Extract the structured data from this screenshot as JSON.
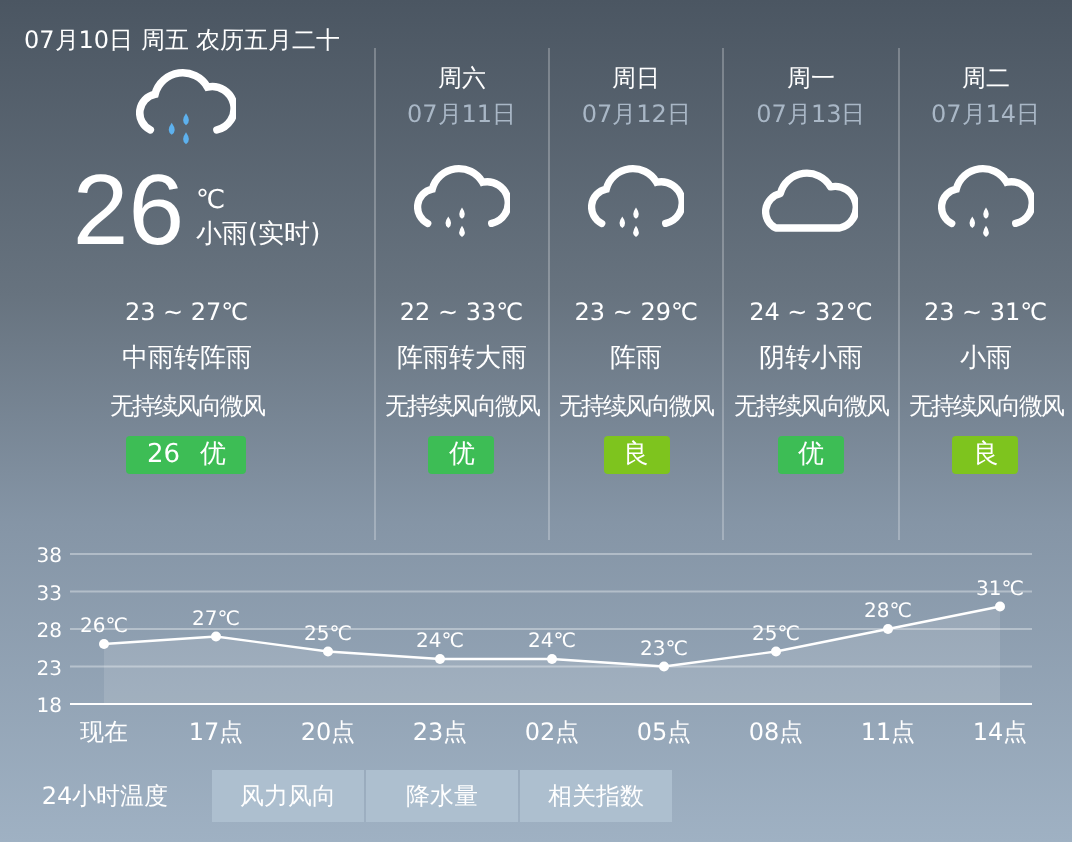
{
  "header": {
    "date_line": "07月10日 周五 农历五月二十"
  },
  "today": {
    "kind": "rain",
    "temperature": "26",
    "unit": "℃",
    "condition": "小雨(实时)",
    "range": "23 ~ 27℃",
    "forecast": "中雨转阵雨",
    "wind": "无持续风向微风",
    "aqi": {
      "label": "26 优",
      "color": "#3dbd55"
    }
  },
  "days": [
    {
      "weekday": "周六",
      "date": "07月11日",
      "kind": "rain",
      "range": "22 ~ 33℃",
      "forecast": "阵雨转大雨",
      "wind": "无持续风向微风",
      "aqi": {
        "label": "优",
        "color": "#3dbd55"
      }
    },
    {
      "weekday": "周日",
      "date": "07月12日",
      "kind": "rain",
      "range": "23 ~ 29℃",
      "forecast": "阵雨",
      "wind": "无持续风向微风",
      "aqi": {
        "label": "良",
        "color": "#7ec41e"
      }
    },
    {
      "weekday": "周一",
      "date": "07月13日",
      "kind": "cloud",
      "range": "24 ~ 32℃",
      "forecast": "阴转小雨",
      "wind": "无持续风向微风",
      "aqi": {
        "label": "优",
        "color": "#3dbd55"
      }
    },
    {
      "weekday": "周二",
      "date": "07月14日",
      "kind": "rain",
      "range": "23 ~ 31℃",
      "forecast": "小雨",
      "wind": "无持续风向微风",
      "aqi": {
        "label": "良",
        "color": "#7ec41e"
      }
    }
  ],
  "hourly": {
    "chart_data": {
      "type": "area",
      "grid": true,
      "categories": [
        "现在",
        "17点",
        "20点",
        "23点",
        "02点",
        "05点",
        "08点",
        "11点",
        "14点"
      ],
      "series": [
        {
          "color": "#ffffff",
          "marker": true,
          "values": [
            26,
            27,
            25,
            24,
            24,
            23,
            25,
            28,
            31
          ]
        }
      ],
      "ylim": [
        18,
        38
      ],
      "yticks": [
        18,
        23,
        28,
        33,
        38
      ],
      "value_labels": [
        "26℃",
        "27℃",
        "25℃",
        "24℃",
        "24℃",
        "23℃",
        "25℃",
        "28℃",
        "31℃"
      ]
    }
  },
  "tabs": [
    {
      "label": "24小时温度",
      "selected": true
    },
    {
      "label": "风力风向",
      "selected": false
    },
    {
      "label": "降水量",
      "selected": false
    },
    {
      "label": "相关指数",
      "selected": false
    }
  ]
}
